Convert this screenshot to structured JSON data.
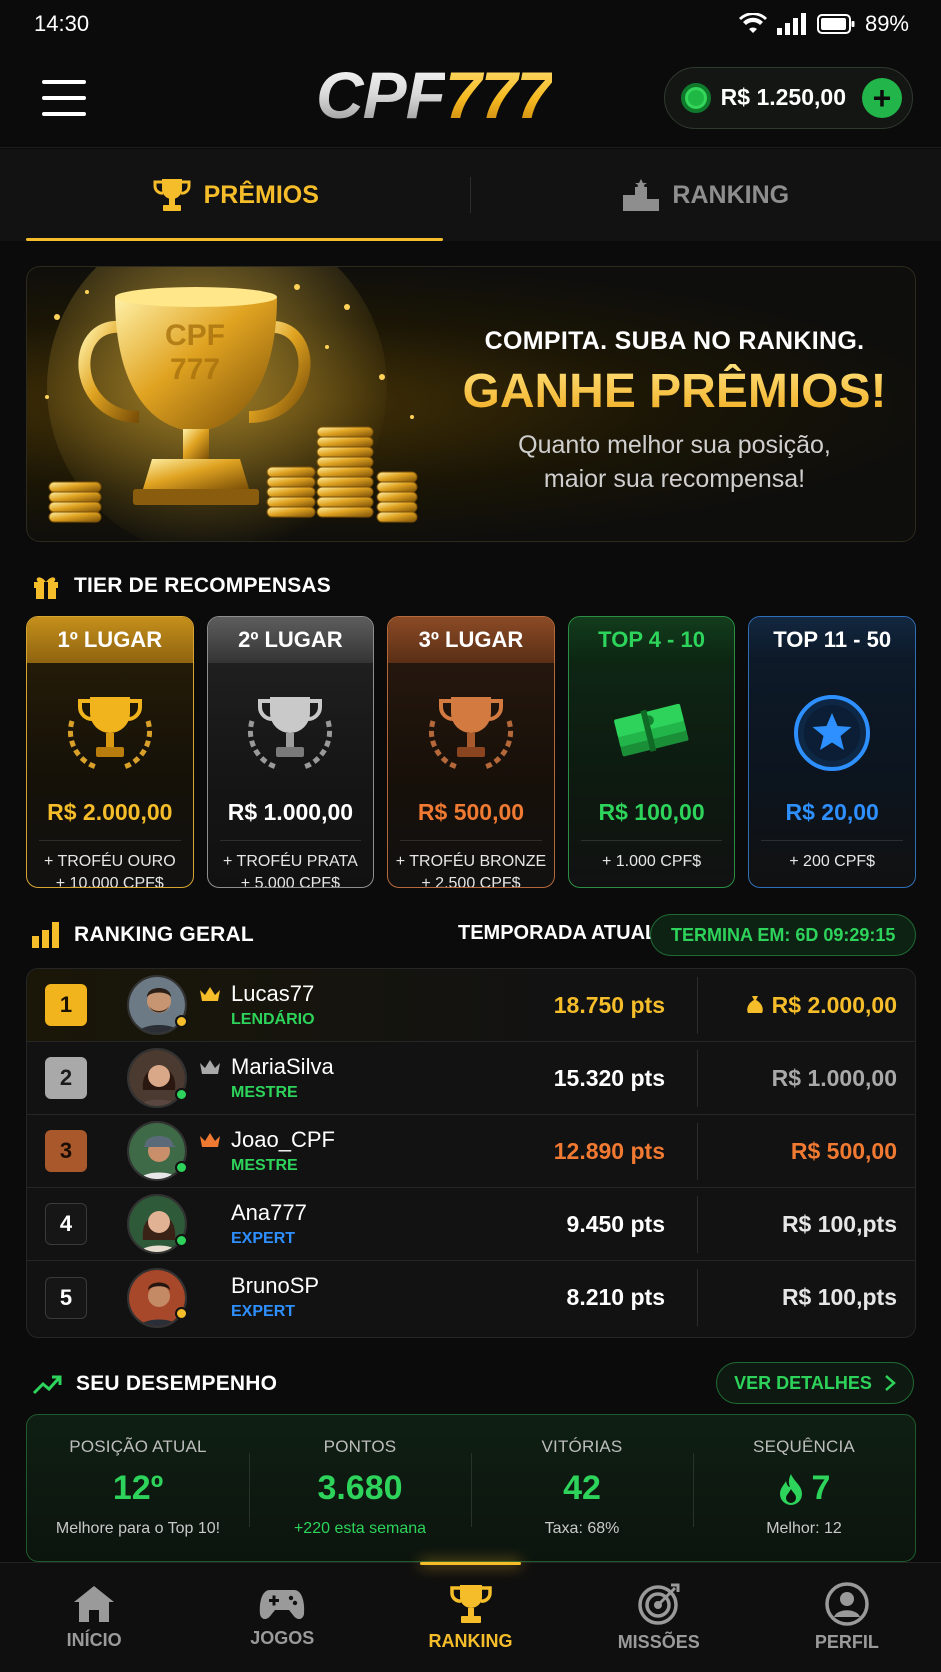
{
  "status": {
    "time": "14:30",
    "battery": "89%"
  },
  "header": {
    "logo_cpf": "CPF",
    "logo_num": "777",
    "balance": "R$ 1.250,00",
    "add_label": "+"
  },
  "tabs": [
    {
      "label": "PRÊMIOS",
      "active": true
    },
    {
      "label": "RANKING",
      "active": false
    }
  ],
  "hero": {
    "subtitle": "COMPITA. SUBA NO RANKING.",
    "title": "GANHE PRÊMIOS!",
    "desc_line1": "Quanto melhor sua posição,",
    "desc_line2": "maior sua recompensa!",
    "trophy_text_1": "CPF",
    "trophy_text_2": "777"
  },
  "tiers_section": {
    "title": "TIER DE RECOMPENSAS"
  },
  "tiers": [
    {
      "label": "1º LUGAR",
      "value": "R$ 2.000,00",
      "line1": "+ TROFÉU OURO",
      "line2": "+ 10.000 CPF$"
    },
    {
      "label": "2º LUGAR",
      "value": "R$ 1.000,00",
      "line1": "+ TROFÉU PRATA",
      "line2": "+ 5.000 CPF$"
    },
    {
      "label": "3º LUGAR",
      "value": "R$ 500,00",
      "line1": "+ TROFÉU BRONZE",
      "line2": "+ 2.500 CPF$"
    },
    {
      "label": "TOP 4 - 10",
      "value": "R$ 100,00",
      "line1": "+ 1.000 CPF$",
      "line2": ""
    },
    {
      "label": "TOP 11 - 50",
      "value": "R$ 20,00",
      "line1": "+ 200 CPF$",
      "line2": ""
    }
  ],
  "ranking": {
    "title": "RANKING GERAL",
    "season": "TEMPORADA ATUAL",
    "timer": "TERMINA EM: 6D 09:29:15",
    "rows": [
      {
        "pos": "1",
        "name": "Lucas77",
        "tier": "LENDÁRIO",
        "pts": "18.750 pts",
        "prize": "R$ 2.000,00"
      },
      {
        "pos": "2",
        "name": "MariaSilva",
        "tier": "MESTRE",
        "pts": "15.320 pts",
        "prize": "R$ 1.000,00"
      },
      {
        "pos": "3",
        "name": "Joao_CPF",
        "tier": "MESTRE",
        "pts": "12.890 pts",
        "prize": "R$ 500,00"
      },
      {
        "pos": "4",
        "name": "Ana777",
        "tier": "EXPERT",
        "pts": "9.450 pts",
        "prize": "R$ 100,pts"
      },
      {
        "pos": "5",
        "name": "BrunoSP",
        "tier": "EXPERT",
        "pts": "8.210 pts",
        "prize": "R$ 100,pts"
      }
    ]
  },
  "performance": {
    "title": "SEU DESEMPENHO",
    "details": "VER DETALHES",
    "stats": [
      {
        "label": "POSIÇÃO ATUAL",
        "value": "12º",
        "note": "Melhore para o Top 10!"
      },
      {
        "label": "PONTOS",
        "value": "3.680",
        "note": "+220 esta semana"
      },
      {
        "label": "VITÓRIAS",
        "value": "42",
        "note": "Taxa: 68%"
      },
      {
        "label": "SEQUÊNCIA",
        "value": "7",
        "note": "Melhor: 12"
      }
    ]
  },
  "nav": [
    {
      "label": "INÍCIO",
      "icon": "home-icon"
    },
    {
      "label": "JOGOS",
      "icon": "gamepad-icon"
    },
    {
      "label": "RANKING",
      "icon": "trophy-icon",
      "active": true
    },
    {
      "label": "MISSÕES",
      "icon": "target-icon"
    },
    {
      "label": "PERFIL",
      "icon": "profile-icon"
    }
  ],
  "colors": {
    "gold": "#f5bd2a",
    "green": "#2dd35a",
    "orange": "#f07a32",
    "blue": "#2e8fff",
    "background": "#0b0b0b"
  }
}
